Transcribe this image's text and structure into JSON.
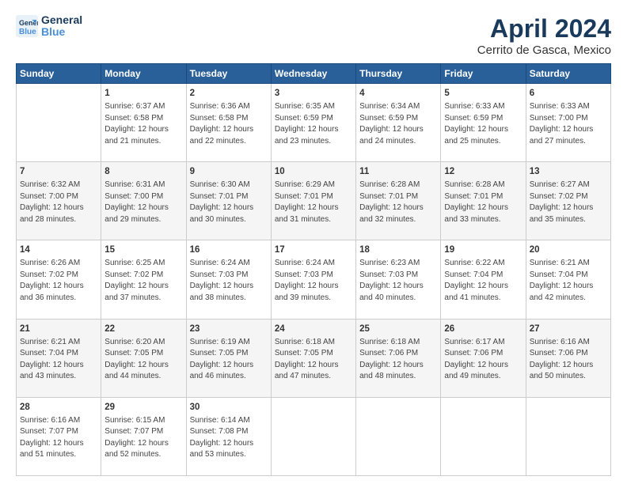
{
  "header": {
    "logo_line1": "General",
    "logo_line2": "Blue",
    "title": "April 2024",
    "subtitle": "Cerrito de Gasca, Mexico"
  },
  "columns": [
    "Sunday",
    "Monday",
    "Tuesday",
    "Wednesday",
    "Thursday",
    "Friday",
    "Saturday"
  ],
  "weeks": [
    [
      {
        "day": "",
        "content": ""
      },
      {
        "day": "1",
        "content": "Sunrise: 6:37 AM\nSunset: 6:58 PM\nDaylight: 12 hours\nand 21 minutes."
      },
      {
        "day": "2",
        "content": "Sunrise: 6:36 AM\nSunset: 6:58 PM\nDaylight: 12 hours\nand 22 minutes."
      },
      {
        "day": "3",
        "content": "Sunrise: 6:35 AM\nSunset: 6:59 PM\nDaylight: 12 hours\nand 23 minutes."
      },
      {
        "day": "4",
        "content": "Sunrise: 6:34 AM\nSunset: 6:59 PM\nDaylight: 12 hours\nand 24 minutes."
      },
      {
        "day": "5",
        "content": "Sunrise: 6:33 AM\nSunset: 6:59 PM\nDaylight: 12 hours\nand 25 minutes."
      },
      {
        "day": "6",
        "content": "Sunrise: 6:33 AM\nSunset: 7:00 PM\nDaylight: 12 hours\nand 27 minutes."
      }
    ],
    [
      {
        "day": "7",
        "content": "Sunrise: 6:32 AM\nSunset: 7:00 PM\nDaylight: 12 hours\nand 28 minutes."
      },
      {
        "day": "8",
        "content": "Sunrise: 6:31 AM\nSunset: 7:00 PM\nDaylight: 12 hours\nand 29 minutes."
      },
      {
        "day": "9",
        "content": "Sunrise: 6:30 AM\nSunset: 7:01 PM\nDaylight: 12 hours\nand 30 minutes."
      },
      {
        "day": "10",
        "content": "Sunrise: 6:29 AM\nSunset: 7:01 PM\nDaylight: 12 hours\nand 31 minutes."
      },
      {
        "day": "11",
        "content": "Sunrise: 6:28 AM\nSunset: 7:01 PM\nDaylight: 12 hours\nand 32 minutes."
      },
      {
        "day": "12",
        "content": "Sunrise: 6:28 AM\nSunset: 7:01 PM\nDaylight: 12 hours\nand 33 minutes."
      },
      {
        "day": "13",
        "content": "Sunrise: 6:27 AM\nSunset: 7:02 PM\nDaylight: 12 hours\nand 35 minutes."
      }
    ],
    [
      {
        "day": "14",
        "content": "Sunrise: 6:26 AM\nSunset: 7:02 PM\nDaylight: 12 hours\nand 36 minutes."
      },
      {
        "day": "15",
        "content": "Sunrise: 6:25 AM\nSunset: 7:02 PM\nDaylight: 12 hours\nand 37 minutes."
      },
      {
        "day": "16",
        "content": "Sunrise: 6:24 AM\nSunset: 7:03 PM\nDaylight: 12 hours\nand 38 minutes."
      },
      {
        "day": "17",
        "content": "Sunrise: 6:24 AM\nSunset: 7:03 PM\nDaylight: 12 hours\nand 39 minutes."
      },
      {
        "day": "18",
        "content": "Sunrise: 6:23 AM\nSunset: 7:03 PM\nDaylight: 12 hours\nand 40 minutes."
      },
      {
        "day": "19",
        "content": "Sunrise: 6:22 AM\nSunset: 7:04 PM\nDaylight: 12 hours\nand 41 minutes."
      },
      {
        "day": "20",
        "content": "Sunrise: 6:21 AM\nSunset: 7:04 PM\nDaylight: 12 hours\nand 42 minutes."
      }
    ],
    [
      {
        "day": "21",
        "content": "Sunrise: 6:21 AM\nSunset: 7:04 PM\nDaylight: 12 hours\nand 43 minutes."
      },
      {
        "day": "22",
        "content": "Sunrise: 6:20 AM\nSunset: 7:05 PM\nDaylight: 12 hours\nand 44 minutes."
      },
      {
        "day": "23",
        "content": "Sunrise: 6:19 AM\nSunset: 7:05 PM\nDaylight: 12 hours\nand 46 minutes."
      },
      {
        "day": "24",
        "content": "Sunrise: 6:18 AM\nSunset: 7:05 PM\nDaylight: 12 hours\nand 47 minutes."
      },
      {
        "day": "25",
        "content": "Sunrise: 6:18 AM\nSunset: 7:06 PM\nDaylight: 12 hours\nand 48 minutes."
      },
      {
        "day": "26",
        "content": "Sunrise: 6:17 AM\nSunset: 7:06 PM\nDaylight: 12 hours\nand 49 minutes."
      },
      {
        "day": "27",
        "content": "Sunrise: 6:16 AM\nSunset: 7:06 PM\nDaylight: 12 hours\nand 50 minutes."
      }
    ],
    [
      {
        "day": "28",
        "content": "Sunrise: 6:16 AM\nSunset: 7:07 PM\nDaylight: 12 hours\nand 51 minutes."
      },
      {
        "day": "29",
        "content": "Sunrise: 6:15 AM\nSunset: 7:07 PM\nDaylight: 12 hours\nand 52 minutes."
      },
      {
        "day": "30",
        "content": "Sunrise: 6:14 AM\nSunset: 7:08 PM\nDaylight: 12 hours\nand 53 minutes."
      },
      {
        "day": "",
        "content": ""
      },
      {
        "day": "",
        "content": ""
      },
      {
        "day": "",
        "content": ""
      },
      {
        "day": "",
        "content": ""
      }
    ]
  ]
}
